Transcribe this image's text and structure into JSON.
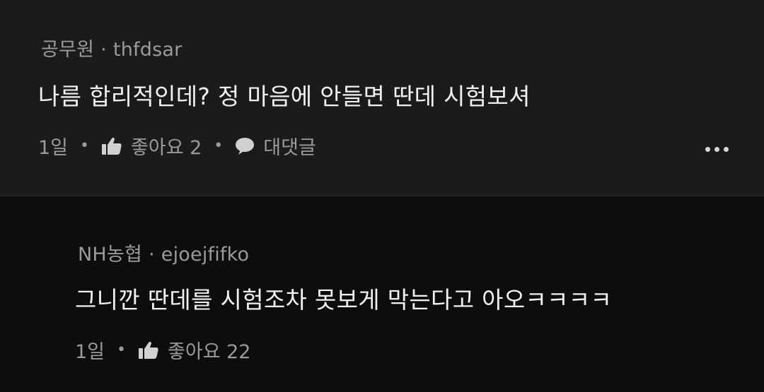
{
  "comment": {
    "affiliation": "공무원",
    "separator": "·",
    "username": "thfdsar",
    "text": "나름 합리적인데? 정 마음에 안들면 딴데 시험보셔",
    "time": "1일",
    "like_label": "좋아요 2",
    "reply_label": "대댓글",
    "icons": [
      "thumbs-up-icon",
      "speech-bubble-icon",
      "more-options-icon"
    ]
  },
  "reply": {
    "affiliation": "NH농협",
    "separator": "·",
    "username": "ejoejfifko",
    "text": "그니깐 딴데를 시험조차 못보게 막는다고 아오ㅋㅋㅋㅋ",
    "time": "1일",
    "like_label": "좋아요 22",
    "icons": [
      "thumbs-up-icon"
    ]
  },
  "colors": {
    "comment_bg": "#1b1b1b",
    "reply_bg": "#0d0d0d",
    "text_primary": "#f1f1f1",
    "text_secondary": "#9a9a9a"
  }
}
